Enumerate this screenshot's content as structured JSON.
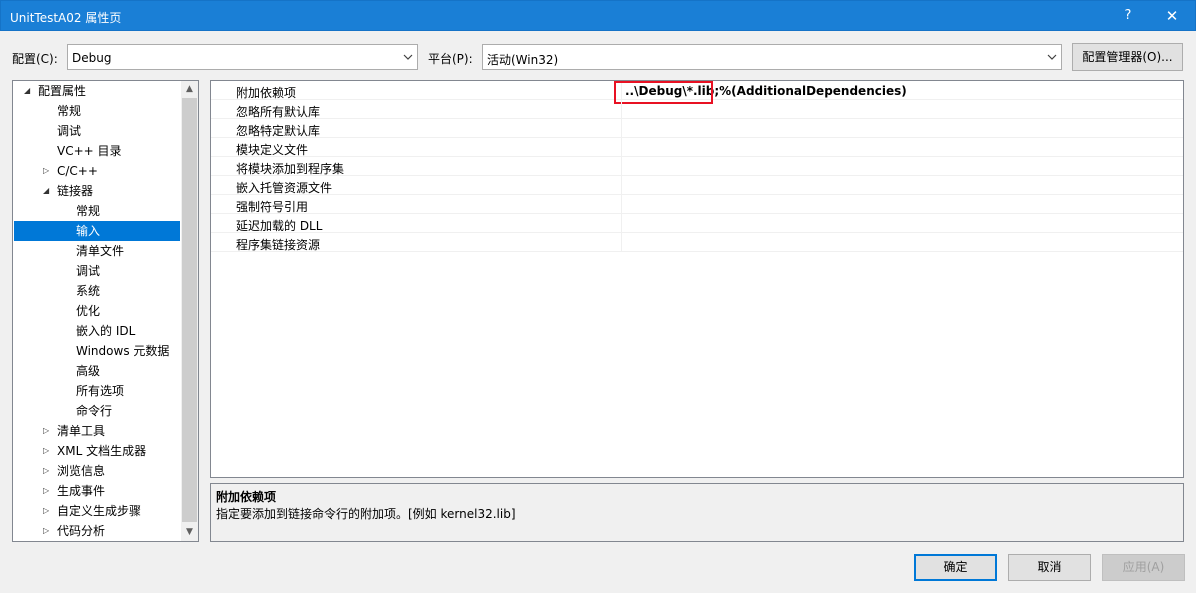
{
  "window": {
    "title": "UnitTestA02 属性页",
    "help_glyph": "?",
    "close_glyph": "✕"
  },
  "config": {
    "config_label": "配置(C):",
    "config_value": "Debug",
    "platform_label": "平台(P):",
    "platform_value": "活动(Win32)",
    "manager_button": "配置管理器(O)..."
  },
  "tree": {
    "items": [
      {
        "label": "配置属性",
        "expander": "◢"
      },
      {
        "label": "常规"
      },
      {
        "label": "调试"
      },
      {
        "label": "VC++ 目录"
      },
      {
        "label": "C/C++",
        "expander": "▷"
      },
      {
        "label": "链接器",
        "expander": "◢"
      },
      {
        "label": "常规"
      },
      {
        "label": "输入",
        "selected": true
      },
      {
        "label": "清单文件"
      },
      {
        "label": "调试"
      },
      {
        "label": "系统"
      },
      {
        "label": "优化"
      },
      {
        "label": "嵌入的 IDL"
      },
      {
        "label": "Windows 元数据"
      },
      {
        "label": "高级"
      },
      {
        "label": "所有选项"
      },
      {
        "label": "命令行"
      },
      {
        "label": "清单工具",
        "expander": "▷"
      },
      {
        "label": "XML 文档生成器",
        "expander": "▷"
      },
      {
        "label": "浏览信息",
        "expander": "▷"
      },
      {
        "label": "生成事件",
        "expander": "▷"
      },
      {
        "label": "自定义生成步骤",
        "expander": "▷"
      },
      {
        "label": "代码分析",
        "expander": "▷"
      }
    ],
    "scroll_up_glyph": "▲",
    "scroll_down_glyph": "▼"
  },
  "properties": {
    "rows": [
      {
        "name": "附加依赖项",
        "value": "..\\Debug\\*.lib;%(AdditionalDependencies)"
      },
      {
        "name": "忽略所有默认库",
        "value": ""
      },
      {
        "name": "忽略特定默认库",
        "value": ""
      },
      {
        "name": "模块定义文件",
        "value": ""
      },
      {
        "name": "将模块添加到程序集",
        "value": ""
      },
      {
        "name": "嵌入托管资源文件",
        "value": ""
      },
      {
        "name": "强制符号引用",
        "value": ""
      },
      {
        "name": "延迟加载的 DLL",
        "value": ""
      },
      {
        "name": "程序集链接资源",
        "value": ""
      }
    ]
  },
  "description": {
    "title": "附加依赖项",
    "text": "指定要添加到链接命令行的附加项。[例如 kernel32.lib]"
  },
  "buttons": {
    "ok": "确定",
    "cancel": "取消",
    "apply": "应用(A)"
  },
  "colors": {
    "titlebar": "#1a7fd6",
    "selection": "#0078d7",
    "highlight_box": "#e81123"
  }
}
